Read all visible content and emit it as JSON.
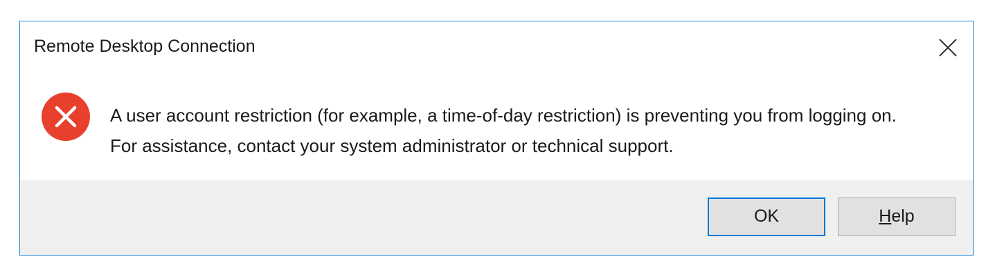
{
  "dialog": {
    "title": "Remote Desktop Connection",
    "close_icon": "close-icon",
    "error_icon": "error-icon",
    "error_color": "#e8402d",
    "message": "A user account restriction (for example, a time-of-day restriction) is preventing you from logging on. For assistance, contact your system administrator or technical support.",
    "buttons": {
      "ok_label": "OK",
      "help_label": "Help"
    },
    "accent_color": "#0078d7"
  }
}
